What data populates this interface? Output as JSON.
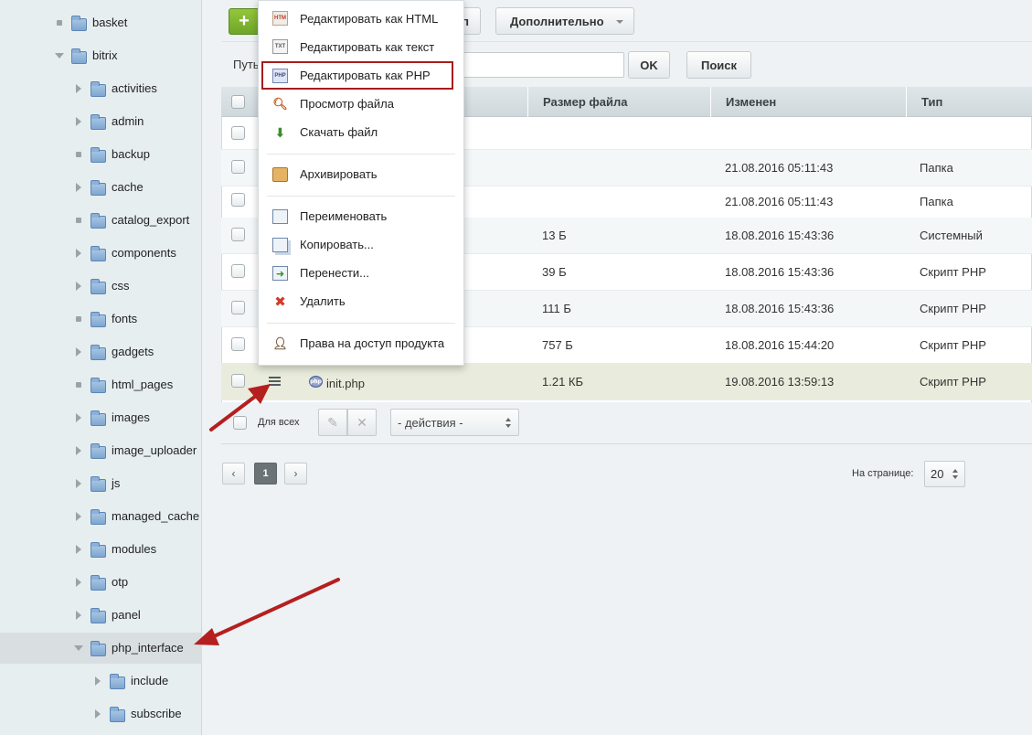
{
  "sidebar": {
    "items": [
      {
        "label": "basket",
        "marker": "dot",
        "level": 1
      },
      {
        "label": "bitrix",
        "marker": "down",
        "level": 1
      },
      {
        "label": "activities",
        "marker": "right",
        "level": 2
      },
      {
        "label": "admin",
        "marker": "right",
        "level": 2
      },
      {
        "label": "backup",
        "marker": "dot",
        "level": 2
      },
      {
        "label": "cache",
        "marker": "right",
        "level": 2
      },
      {
        "label": "catalog_export",
        "marker": "dot",
        "level": 2
      },
      {
        "label": "components",
        "marker": "right",
        "level": 2
      },
      {
        "label": "css",
        "marker": "right",
        "level": 2
      },
      {
        "label": "fonts",
        "marker": "dot",
        "level": 2
      },
      {
        "label": "gadgets",
        "marker": "right",
        "level": 2
      },
      {
        "label": "html_pages",
        "marker": "dot",
        "level": 2
      },
      {
        "label": "images",
        "marker": "right",
        "level": 2
      },
      {
        "label": "image_uploader",
        "marker": "right",
        "level": 2
      },
      {
        "label": "js",
        "marker": "right",
        "level": 2
      },
      {
        "label": "managed_cache",
        "marker": "right",
        "level": 2
      },
      {
        "label": "modules",
        "marker": "right",
        "level": 2
      },
      {
        "label": "otp",
        "marker": "right",
        "level": 2
      },
      {
        "label": "panel",
        "marker": "right",
        "level": 2
      },
      {
        "label": "php_interface",
        "marker": "down",
        "level": 2,
        "selected": true
      },
      {
        "label": "include",
        "marker": "right",
        "level": 3
      },
      {
        "label": "subscribe",
        "marker": "right",
        "level": 3
      }
    ]
  },
  "toolbar": {
    "add_label": "+",
    "partial_button_label": "п",
    "more_label": "Дополнительно",
    "path_label": "Путь",
    "ok_label": "OK",
    "search_label": "Поиск"
  },
  "table": {
    "columns": [
      "Размер файла",
      "Изменен",
      "Тип"
    ],
    "rows": [
      {
        "name": "",
        "size": "",
        "modified": "",
        "type": ""
      },
      {
        "name": "",
        "size": "",
        "modified": "21.08.2016 05:11:43",
        "type": "Папка"
      },
      {
        "name": "",
        "size": "",
        "modified": "21.08.2016 05:11:43",
        "type": "Папка"
      },
      {
        "name": "",
        "size": "13 Б",
        "modified": "18.08.2016 15:43:36",
        "type": "Системный"
      },
      {
        "name": "",
        "size": "39 Б",
        "modified": "18.08.2016 15:43:36",
        "type": "Скрипт PHP"
      },
      {
        "name": "",
        "size": "111 Б",
        "modified": "18.08.2016 15:43:36",
        "type": "Скрипт PHP"
      },
      {
        "name": "",
        "size": "757 Б",
        "modified": "18.08.2016 15:44:20",
        "type": "Скрипт PHP"
      },
      {
        "name": "init.php",
        "size": "1.21 КБ",
        "modified": "19.08.2016 13:59:13",
        "type": "Скрипт PHP"
      }
    ],
    "for_all_label": "Для всех",
    "actions_select": "- действия -"
  },
  "pagination": {
    "prev": "‹",
    "current_page": "1",
    "next": "›",
    "per_page_label": "На странице:",
    "per_page_value": "20"
  },
  "context_menu": {
    "items": [
      {
        "label": "Редактировать как HTML",
        "icon": "edit-html-icon"
      },
      {
        "label": "Редактировать как текст",
        "icon": "edit-text-icon"
      },
      {
        "label": "Редактировать как PHP",
        "icon": "edit-php-icon",
        "active": true
      },
      {
        "label": "Просмотр файла",
        "icon": "view-file-icon"
      },
      {
        "label": "Скачать файл",
        "icon": "download-icon"
      },
      {
        "label": "Архивировать",
        "icon": "archive-icon"
      },
      {
        "label": "Переименовать",
        "icon": "rename-icon"
      },
      {
        "label": "Копировать...",
        "icon": "copy-icon"
      },
      {
        "label": "Перенести...",
        "icon": "move-icon"
      },
      {
        "label": "Удалить",
        "icon": "delete-icon"
      },
      {
        "label": "Права на доступ продукта",
        "icon": "access-rights-icon"
      }
    ]
  },
  "colors": {
    "accent_green": "#7ab333",
    "annotation_arrow": "#b51f1f",
    "active_border": "#a71c1c"
  }
}
